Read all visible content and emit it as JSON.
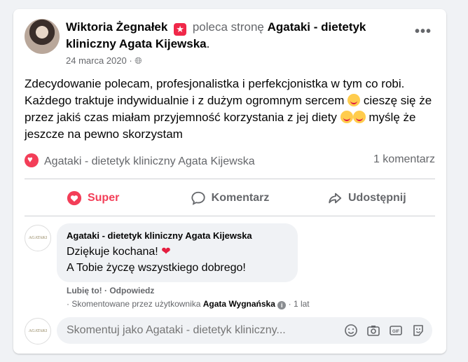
{
  "post": {
    "author": "Wiktoria Żegnałek",
    "recommends": "poleca stronę",
    "page": "Agataki - dietetyk kliniczny Agata Kijewska",
    "period": ".",
    "date": "24 marca 2020",
    "separator": " · ",
    "text": "Zdecydowanie polecam, profesjonalistka i perfekcjonistka w tym co robi. Każdego traktuje indywidualnie i z dużym ogromnym sercem",
    "text2": "cieszę się że przez jakiś czas miałam przyjemność korzystania z jej diety",
    "text3": "myślę że jeszcze na pewno skorzystam"
  },
  "reactions": {
    "reacted_by": "Agataki - dietetyk kliniczny Agata Kijewska",
    "comments_count": "1 komentarz"
  },
  "actions": {
    "super": "Super",
    "comment": "Komentarz",
    "share": "Udostępnij"
  },
  "comment": {
    "avatar_text": "AGATAKI",
    "author": "Agataki - dietetyk kliniczny Agata Kijewska",
    "line1": "Dziękuje kochana!",
    "line2": "A Tobie życzę wszystkiego dobrego!",
    "like": "Lubię to!",
    "dot": " · ",
    "reply": "Odpowiedz",
    "commented_by_prefix": "· Skomentowane przez użytkownika",
    "commented_by_name": "Agata Wygnańska",
    "age": "· 1 lat"
  },
  "compose": {
    "placeholder": "Skomentuj jako Agataki - dietetyk kliniczny..."
  },
  "colors": {
    "accent_red": "#f33e58",
    "secondary_text": "#65676b"
  }
}
